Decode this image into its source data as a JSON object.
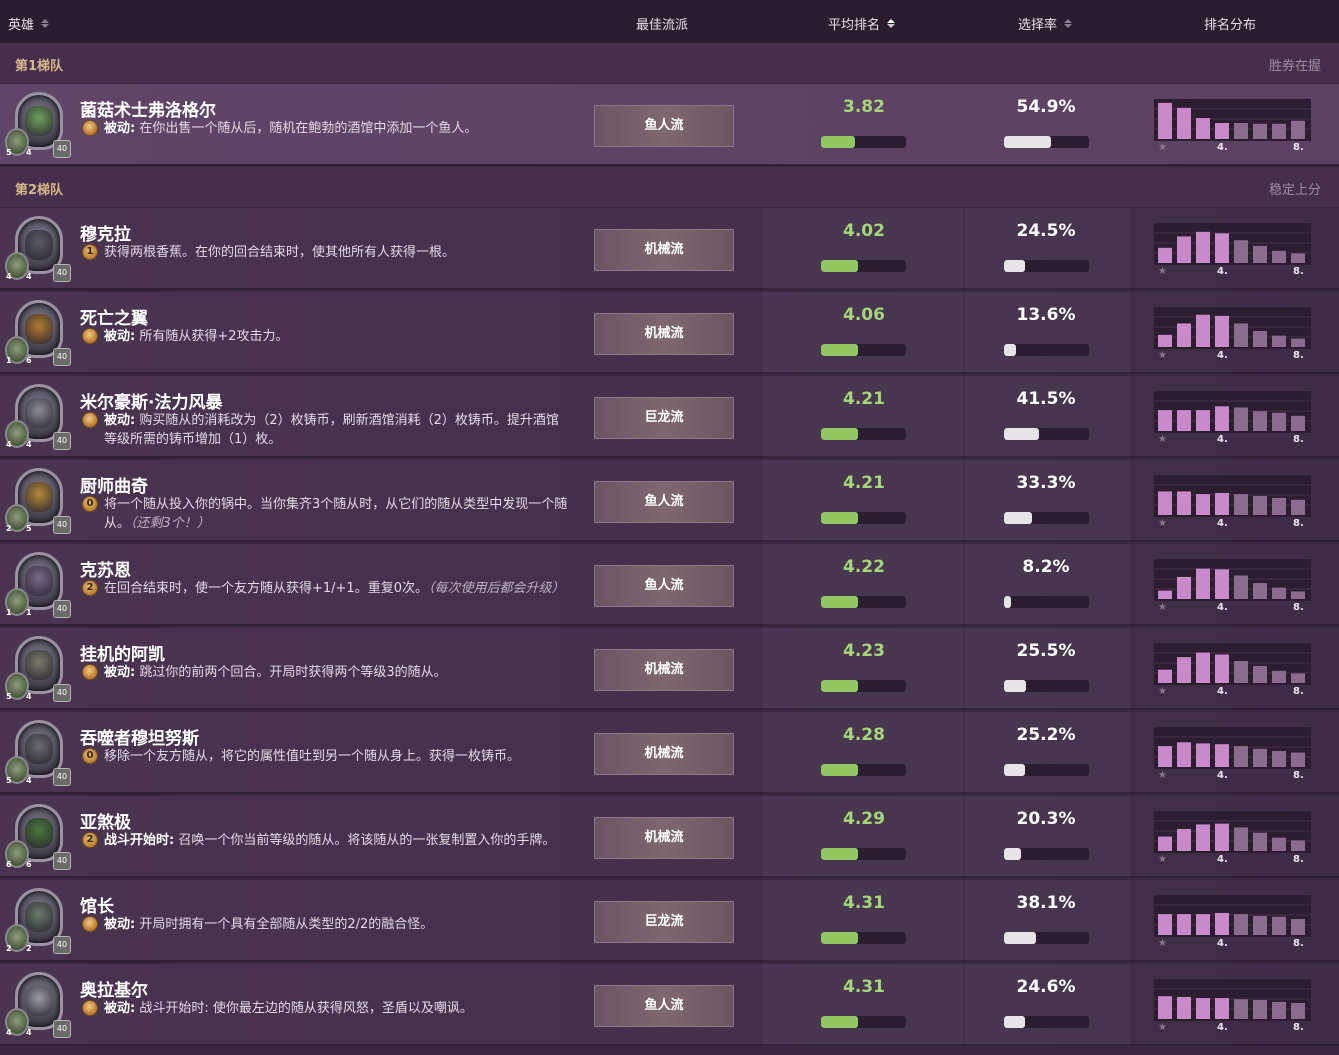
{
  "header": {
    "hero": "英雄",
    "best_comp": "最佳流派",
    "avg_rank": "平均排名",
    "pick_rate": "选择率",
    "distribution": "排名分布"
  },
  "dist_labels": {
    "mid": "4.",
    "end": "8."
  },
  "tiers": [
    {
      "name": "第1梯队",
      "desc": "胜券在握"
    },
    {
      "name": "第2梯队",
      "desc": "稳定上分"
    }
  ],
  "colors": {
    "accent_green": "#a6d67a",
    "bar_green": "#93c763",
    "bar_pink": "#c98ac9",
    "tier_gold": "#d6b88e"
  },
  "heroes": [
    {
      "tier": 0,
      "name": "菌菇术士弗洛格尔",
      "cost": "",
      "cost_type": "passive",
      "power_bold": "被动:",
      "power_text": " 在你出售一个随从后，随机在鲍勃的酒馆中添加一个鱼人。",
      "power_italic": "",
      "comp": "鱼人流",
      "avg": "3.82",
      "avg_fill": 0.4,
      "pick": "54.9%",
      "pick_fill": 0.549,
      "dist": [
        0.95,
        0.82,
        0.55,
        0.42,
        0.42,
        0.4,
        0.4,
        0.48
      ],
      "atk": "5",
      "hp": "4",
      "armor": "40",
      "face": "#6fa05a"
    },
    {
      "tier": 1,
      "name": "穆克拉",
      "cost": "1",
      "cost_type": "cost",
      "power_bold": "",
      "power_text": "获得两根香蕉。在你的回合结束时，使其他所有人获得一根。",
      "power_italic": "",
      "comp": "机械流",
      "avg": "4.02",
      "avg_fill": 0.44,
      "pick": "24.5%",
      "pick_fill": 0.245,
      "dist": [
        0.4,
        0.7,
        0.82,
        0.78,
        0.6,
        0.45,
        0.32,
        0.25
      ],
      "atk": "4",
      "hp": "4",
      "armor": "40",
      "face": "#5a5a68"
    },
    {
      "tier": 1,
      "name": "死亡之翼",
      "cost": "",
      "cost_type": "passive",
      "power_bold": "被动:",
      "power_text": " 所有随从获得+2攻击力。",
      "power_italic": "",
      "comp": "机械流",
      "avg": "4.06",
      "avg_fill": 0.44,
      "pick": "13.6%",
      "pick_fill": 0.136,
      "dist": [
        0.32,
        0.62,
        0.85,
        0.82,
        0.62,
        0.42,
        0.3,
        0.22
      ],
      "atk": "1",
      "hp": "6",
      "armor": "40",
      "face": "#b07a30"
    },
    {
      "tier": 1,
      "name": "米尔豪斯·法力风暴",
      "cost": "",
      "cost_type": "passive",
      "power_bold": "被动:",
      "power_text": " 购买随从的消耗改为（2）枚铸币，刷新酒馆消耗（2）枚铸币。提升酒馆等级所需的铸币增加（1）枚。",
      "power_italic": "",
      "comp": "巨龙流",
      "avg": "4.21",
      "avg_fill": 0.44,
      "pick": "41.5%",
      "pick_fill": 0.415,
      "dist": [
        0.55,
        0.55,
        0.55,
        0.65,
        0.62,
        0.52,
        0.48,
        0.4
      ],
      "atk": "4",
      "hp": "4",
      "armor": "40",
      "face": "#8c8c9a"
    },
    {
      "tier": 1,
      "name": "厨师曲奇",
      "cost": "0",
      "cost_type": "cost",
      "power_bold": "",
      "power_text": "将一个随从投入你的锅中。当你集齐3个随从时，从它们的随从类型中发现一个随从。",
      "power_italic": "（还剩3个！）",
      "comp": "鱼人流",
      "avg": "4.21",
      "avg_fill": 0.44,
      "pick": "33.3%",
      "pick_fill": 0.333,
      "dist": [
        0.62,
        0.62,
        0.55,
        0.58,
        0.55,
        0.5,
        0.45,
        0.4
      ],
      "atk": "2",
      "hp": "5",
      "armor": "40",
      "face": "#b58a3a"
    },
    {
      "tier": 1,
      "name": "克苏恩",
      "cost": "2",
      "cost_type": "cost",
      "power_bold": "",
      "power_text": "在回合结束时，使一个友方随从获得+1/+1。重复0次。",
      "power_italic": "（每次使用后都会升级）",
      "comp": "鱼人流",
      "avg": "4.22",
      "avg_fill": 0.44,
      "pick": "8.2%",
      "pick_fill": 0.082,
      "dist": [
        0.22,
        0.58,
        0.8,
        0.78,
        0.62,
        0.42,
        0.3,
        0.2
      ],
      "atk": "1",
      "hp": "1",
      "armor": "40",
      "face": "#7a6a8a"
    },
    {
      "tier": 1,
      "name": "挂机的阿凯",
      "cost": "",
      "cost_type": "passive",
      "power_bold": "被动:",
      "power_text": " 跳过你的前两个回合。开局时获得两个等级3的随从。",
      "power_italic": "",
      "comp": "机械流",
      "avg": "4.23",
      "avg_fill": 0.44,
      "pick": "25.5%",
      "pick_fill": 0.255,
      "dist": [
        0.35,
        0.68,
        0.8,
        0.75,
        0.58,
        0.45,
        0.32,
        0.25
      ],
      "atk": "5",
      "hp": "4",
      "armor": "40",
      "face": "#7a7a6a"
    },
    {
      "tier": 1,
      "name": "吞噬者穆坦努斯",
      "cost": "0",
      "cost_type": "cost",
      "power_bold": "",
      "power_text": "移除一个友方随从，将它的属性值吐到另一个随从身上。获得一枚铸币。",
      "power_italic": "",
      "comp": "机械流",
      "avg": "4.28",
      "avg_fill": 0.44,
      "pick": "25.2%",
      "pick_fill": 0.252,
      "dist": [
        0.55,
        0.65,
        0.62,
        0.6,
        0.55,
        0.48,
        0.42,
        0.38
      ],
      "atk": "5",
      "hp": "4",
      "armor": "40",
      "face": "#6a6a70"
    },
    {
      "tier": 1,
      "name": "亚煞极",
      "cost": "2",
      "cost_type": "cost",
      "power_bold": "战斗开始时:",
      "power_text": " 召唤一个你当前等级的随从。将该随从的一张复制置入你的手牌。",
      "power_italic": "",
      "comp": "机械流",
      "avg": "4.29",
      "avg_fill": 0.44,
      "pick": "20.3%",
      "pick_fill": 0.203,
      "dist": [
        0.38,
        0.58,
        0.7,
        0.72,
        0.62,
        0.48,
        0.35,
        0.28
      ],
      "atk": "6",
      "hp": "6",
      "armor": "40",
      "face": "#4a7a3a"
    },
    {
      "tier": 1,
      "name": "馆长",
      "cost": "",
      "cost_type": "passive",
      "power_bold": "被动:",
      "power_text": " 开局时拥有一个具有全部随从类型的2/2的融合怪。",
      "power_italic": "",
      "comp": "巨龙流",
      "avg": "4.31",
      "avg_fill": 0.44,
      "pick": "38.1%",
      "pick_fill": 0.381,
      "dist": [
        0.55,
        0.55,
        0.55,
        0.58,
        0.55,
        0.5,
        0.48,
        0.42
      ],
      "atk": "2",
      "hp": "2",
      "armor": "40",
      "face": "#6a7a6a"
    },
    {
      "tier": 1,
      "name": "奥拉基尔",
      "cost": "",
      "cost_type": "passive",
      "power_bold": "被动:",
      "power_text": " 战斗开始时: 使你最左边的随从获得风怒，圣盾以及嘲讽。",
      "power_italic": "",
      "comp": "鱼人流",
      "avg": "4.31",
      "avg_fill": 0.44,
      "pick": "24.6%",
      "pick_fill": 0.246,
      "dist": [
        0.6,
        0.58,
        0.55,
        0.55,
        0.52,
        0.5,
        0.45,
        0.42
      ],
      "atk": "4",
      "hp": "4",
      "armor": "40",
      "face": "#9a9aa8"
    }
  ]
}
